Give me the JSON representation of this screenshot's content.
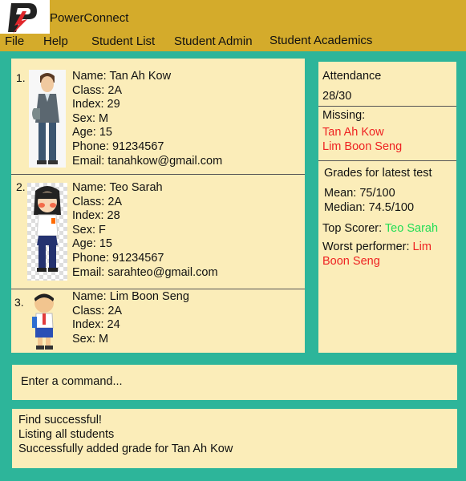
{
  "app": {
    "title": "PowerConnect",
    "logo_letter": "P"
  },
  "menu": [
    "File",
    "Help",
    "Student List",
    "Student Admin",
    "Student Academics"
  ],
  "students": [
    {
      "number": "1.",
      "name": "Name: Tan Ah Kow",
      "class": "Class: 2A",
      "index": "Index: 29",
      "sex": "Sex: M",
      "age": "Age: 15",
      "phone": "Phone: 91234567",
      "email": "Email: tanahkow@gmail.com"
    },
    {
      "number": "2.",
      "name": "Name: Teo Sarah",
      "class": "Class: 2A",
      "index": "Index: 28",
      "sex": "Sex: F",
      "age": "Age: 15",
      "phone": "Phone: 91234567",
      "email": "Email: sarahteo@gmail.com"
    },
    {
      "number": "3.",
      "name": "Name: Lim Boon Seng",
      "class": "Class: 2A",
      "index": "Index: 24",
      "sex": "Sex: M"
    }
  ],
  "stats": {
    "attendance_label": "Attendance",
    "attendance_value": "28/30",
    "missing_label": "Missing:",
    "missing": [
      "Tan Ah Kow",
      "Lim Boon Seng"
    ],
    "grades_title": "Grades for latest test",
    "mean": "Mean: 75/100",
    "median": "Median: 74.5/100",
    "top_scorer_label": "Top Scorer: ",
    "top_scorer": "Teo Sarah",
    "worst_label": "Worst performer: ",
    "worst_first": "Lim",
    "worst_second": "Boon Seng"
  },
  "command": {
    "placeholder": "Enter a command..."
  },
  "result": {
    "lines": [
      "Find successful!",
      "Listing all students",
      "Successfully added grade for Tan Ah Kow"
    ]
  },
  "colors": {
    "background": "#2db59a",
    "menubar": "#d4ab2b",
    "panel": "#fbedb9",
    "missing_text": "#ee2222",
    "top_scorer_text": "#22dd55"
  }
}
